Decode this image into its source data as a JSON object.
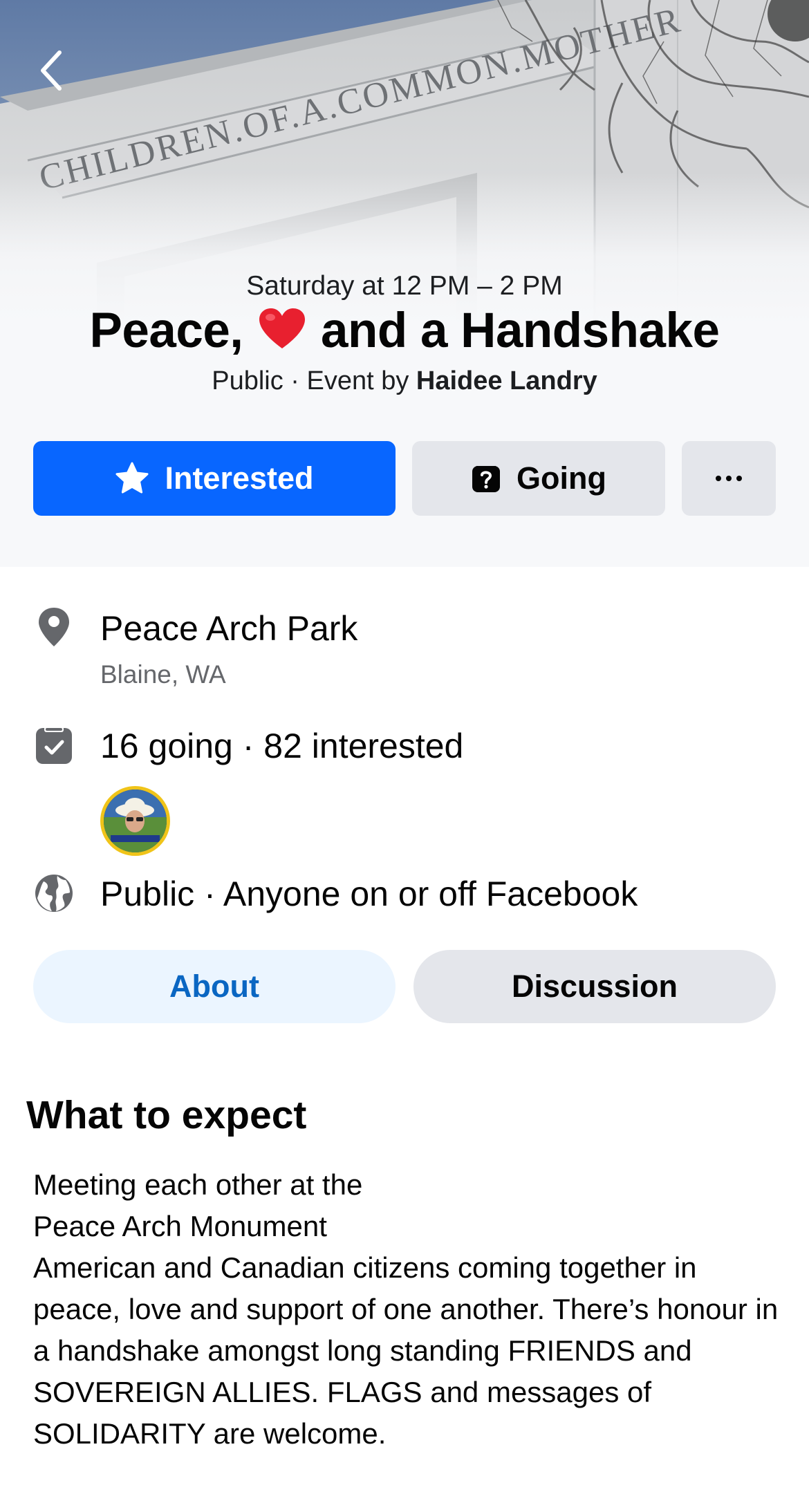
{
  "cover": {
    "image_description": "Stone Peace Arch monument with tree branches",
    "inscription": "CHILDREN.OF.A.COMMON.MOTHER"
  },
  "event": {
    "date_time": "Saturday at 12 PM – 2 PM",
    "title_part1": "Peace,",
    "title_emoji": "heart",
    "title_part2": "and a Handshake",
    "visibility_prefix": "Public · Event by ",
    "host": "Haidee Landry"
  },
  "actions": {
    "interested_label": "Interested",
    "going_label": "Going",
    "more_label": "···"
  },
  "details": {
    "location_name": "Peace Arch Park",
    "location_city": "Blaine, WA",
    "attendance": "16 going · 82 interested",
    "privacy": "Public · Anyone on or off Facebook"
  },
  "tabs": {
    "about": "About",
    "discussion": "Discussion",
    "active": "about"
  },
  "about": {
    "heading": "What to expect",
    "lines": [
      "Meeting each other at the",
      "Peace Arch Monument",
      "American and Canadian citizens coming together in peace, love and support of one another. There’s honour in a handshake amongst long standing FRIENDS and SOVEREIGN ALLIES. FLAGS and messages of SOLIDARITY are welcome."
    ]
  },
  "colors": {
    "primary_blue": "#0866ff",
    "tab_active_bg": "#ebf5ff",
    "tab_active_text": "#0a66c2",
    "secondary_button": "#e4e6eb",
    "muted_text": "#65676b",
    "avatar_ring": "#f0c419"
  }
}
